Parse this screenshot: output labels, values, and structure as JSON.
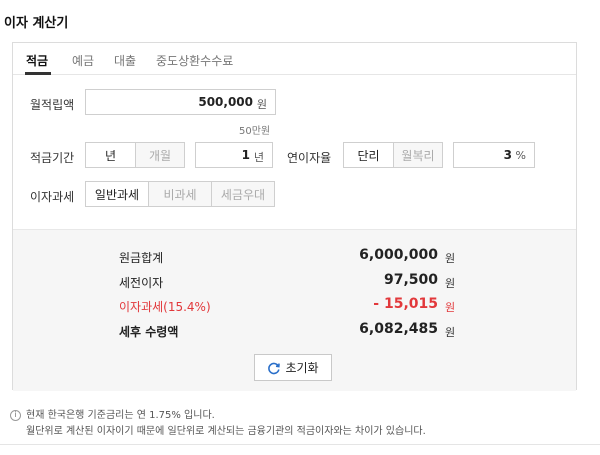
{
  "title": "이자 계산기",
  "tabs": [
    "적금",
    "예금",
    "대출",
    "중도상환수수료"
  ],
  "form": {
    "monthly_label": "월적립액",
    "monthly_value": "500,000",
    "monthly_unit": "원",
    "monthly_hint": "50만원",
    "period_label": "적금기간",
    "period_units": [
      "년",
      "개월"
    ],
    "period_value": "1",
    "period_value_unit": "년",
    "rate_label": "연이자율",
    "rate_types": [
      "단리",
      "월복리"
    ],
    "rate_value": "3",
    "rate_unit": "%",
    "tax_label": "이자과세",
    "tax_options": [
      "일반과세",
      "비과세",
      "세금우대"
    ]
  },
  "result": {
    "principal_label": "원금합계",
    "principal_value": "6,000,000",
    "pretax_label": "세전이자",
    "pretax_value": "97,500",
    "tax_label": "이자과세(15.4%)",
    "tax_value": "- 15,015",
    "net_label": "세후 수령액",
    "net_value": "6,082,485",
    "won": "원"
  },
  "reset_label": "초기화",
  "notes": {
    "line1": "현재 한국은행 기준금리는 연 1.75% 입니다.",
    "line2": "월단위로 계산된 이자이기 때문에 일단위로 계산되는 금융기관의 적금이자와는 차이가 있습니다."
  },
  "colors": {
    "accent_red": "#e2383b"
  }
}
